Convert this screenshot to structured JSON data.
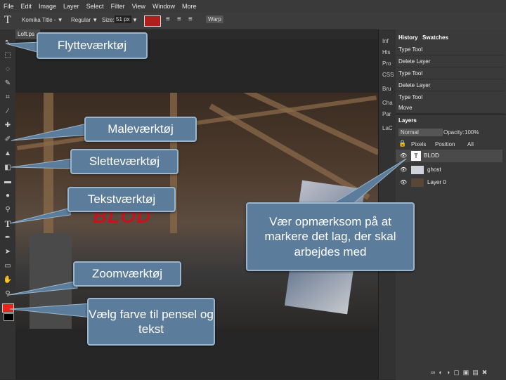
{
  "menu": [
    "File",
    "Edit",
    "Image",
    "Layer",
    "Select",
    "Filter",
    "View",
    "Window",
    "More"
  ],
  "options": {
    "font": "Komika Title - ▼",
    "style": "Regular ▼",
    "size_label": "Size:",
    "size_value": "51 px",
    "size_arrow": "▼",
    "color": "#b01e1e",
    "warp": "Warp"
  },
  "document": {
    "tab": "Loft.ps",
    "text_layer_content": "BLOD"
  },
  "mini_panels": [
    "Inf",
    "His",
    "Pro",
    "CSS",
    "Bru",
    "Cha",
    "Par",
    "LaC"
  ],
  "history": {
    "tabs": [
      "History",
      "Swatches"
    ],
    "items": [
      "Type Tool",
      "Delete Layer",
      "Type Tool",
      "Delete Layer",
      "Type Tool",
      "Move"
    ]
  },
  "layers": {
    "title": "Layers",
    "blend_mode": "Normal",
    "opacity_label": "Opacity:",
    "opacity_value": "100%",
    "lock_label": "Pixels",
    "lock_position": "Position",
    "lock_all": "All",
    "items": [
      {
        "name": "BLOD"
      },
      {
        "name": "ghost"
      },
      {
        "name": "Layer 0"
      }
    ]
  },
  "callouts": {
    "move": "Flytteværktøj",
    "brush": "Maleværktøj",
    "eraser": "Sletteværktøj",
    "text": "Tekstværktøj",
    "zoom": "Zoomværktøj",
    "color": "Vælg farve til pensel og tekst",
    "layer_note": "Vær opmærksom på at markere det lag, der skal arbejdes med"
  },
  "colors": {
    "foreground": "#e8231c",
    "background": "#000000",
    "callout_fill": "#5b7c9b",
    "callout_border": "#9bb6cc"
  }
}
